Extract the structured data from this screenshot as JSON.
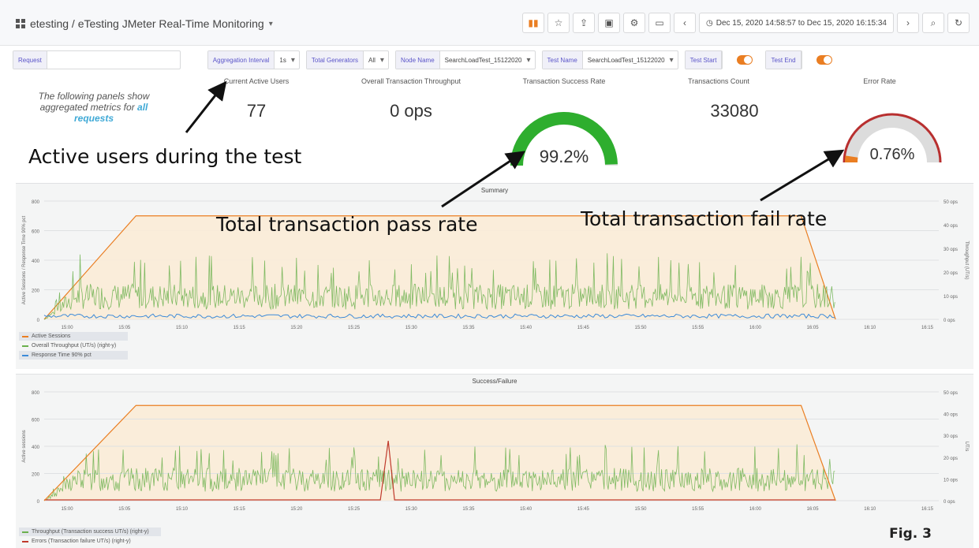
{
  "header": {
    "breadcrumb": "etesting / eTesting JMeter Real-Time Monitoring",
    "time_range": "Dec 15, 2020 14:58:57 to Dec 15, 2020 16:15:34"
  },
  "variables": {
    "request": {
      "label": "Request",
      "value": ""
    },
    "aggregation": {
      "label": "Aggregation Interval",
      "value": "1s"
    },
    "generators": {
      "label": "Total Generators",
      "value": "All"
    },
    "node": {
      "label": "Node Name",
      "value": "SearchLoadTest_15122020"
    },
    "test": {
      "label": "Test Name",
      "value": "SearchLoadTest_15122020"
    },
    "test_start": {
      "label": "Test Start"
    },
    "test_end": {
      "label": "Test End"
    }
  },
  "stats": {
    "note_prefix": "The following panels show aggregated metrics for",
    "note_highlight": "all requests",
    "active_users": {
      "title": "Current Active Users",
      "value": "77"
    },
    "throughput": {
      "title": "Overall Transaction Throughput",
      "value": "0 ops"
    },
    "success_rate": {
      "title": "Transaction Success Rate",
      "value": "99.2%",
      "fraction": 0.992
    },
    "count": {
      "title": "Transactions Count",
      "value": "33080"
    },
    "error_rate": {
      "title": "Error Rate",
      "value": "0.76%",
      "fraction": 0.0076
    }
  },
  "annotations": {
    "active_users": "Active users during the test",
    "pass_rate": "Total transaction pass rate",
    "fail_rate": "Total transaction fail rate",
    "figure": "Fig. 3"
  },
  "colors": {
    "orange": "#ea7e22",
    "green": "#6ab04c",
    "blue": "#3d8bd9",
    "red": "#c0392b",
    "gauge_green": "#2eae2e",
    "gauge_red": "#b82f2f"
  },
  "chart_data": [
    {
      "type": "line",
      "title": "Summary",
      "ylabel": "Active Sessions / Response Time 90% pct",
      "y2label": "Throughput (UT/s)",
      "x_ticks": [
        "15:00",
        "15:05",
        "15:10",
        "15:15",
        "15:20",
        "15:25",
        "15:30",
        "15:35",
        "15:40",
        "15:45",
        "15:50",
        "15:55",
        "16:00",
        "16:05",
        "16:10",
        "16:15"
      ],
      "y_ticks": [
        "0",
        "200",
        "400",
        "600",
        "800"
      ],
      "y2_ticks": [
        "0 ops",
        "10 ops",
        "20 ops",
        "30 ops",
        "40 ops",
        "50 ops"
      ],
      "ylim": [
        0,
        800
      ],
      "series": [
        {
          "name": "Active Sessions",
          "color": "#ea7e22",
          "kind": "plateau",
          "x": [
            "14:58",
            "15:06",
            "16:04",
            "16:07"
          ],
          "y": [
            0,
            700,
            700,
            0
          ]
        },
        {
          "name": "Overall Throughput (UT/s) (right-y)",
          "color": "#6ab04c",
          "kind": "noise",
          "mean_ops": 12,
          "peak_ops": 28
        },
        {
          "name": "Response Time 90% pct",
          "color": "#3d8bd9",
          "kind": "flat",
          "mean": 20
        }
      ]
    },
    {
      "type": "line",
      "title": "Success/Failure",
      "ylabel": "Active sessions",
      "y2label": "UT/s",
      "x_ticks": [
        "15:00",
        "15:05",
        "15:10",
        "15:15",
        "15:20",
        "15:25",
        "15:30",
        "15:35",
        "15:40",
        "15:45",
        "15:50",
        "15:55",
        "16:00",
        "16:05",
        "16:10",
        "16:15"
      ],
      "y_ticks": [
        "0",
        "200",
        "400",
        "600",
        "800"
      ],
      "y2_ticks": [
        "0 ops",
        "10 ops",
        "20 ops",
        "30 ops",
        "40 ops",
        "50 ops"
      ],
      "ylim": [
        0,
        800
      ],
      "series": [
        {
          "name": "Throughput (Transaction success UT/s) (right-y)",
          "color": "#6ab04c",
          "kind": "noise",
          "mean_ops": 12,
          "peak_ops": 26
        },
        {
          "name": "Errors (Transaction failure UT/s) (right-y)",
          "color": "#c0392b",
          "kind": "spike",
          "x": "15:28",
          "peak": 440
        }
      ]
    }
  ]
}
